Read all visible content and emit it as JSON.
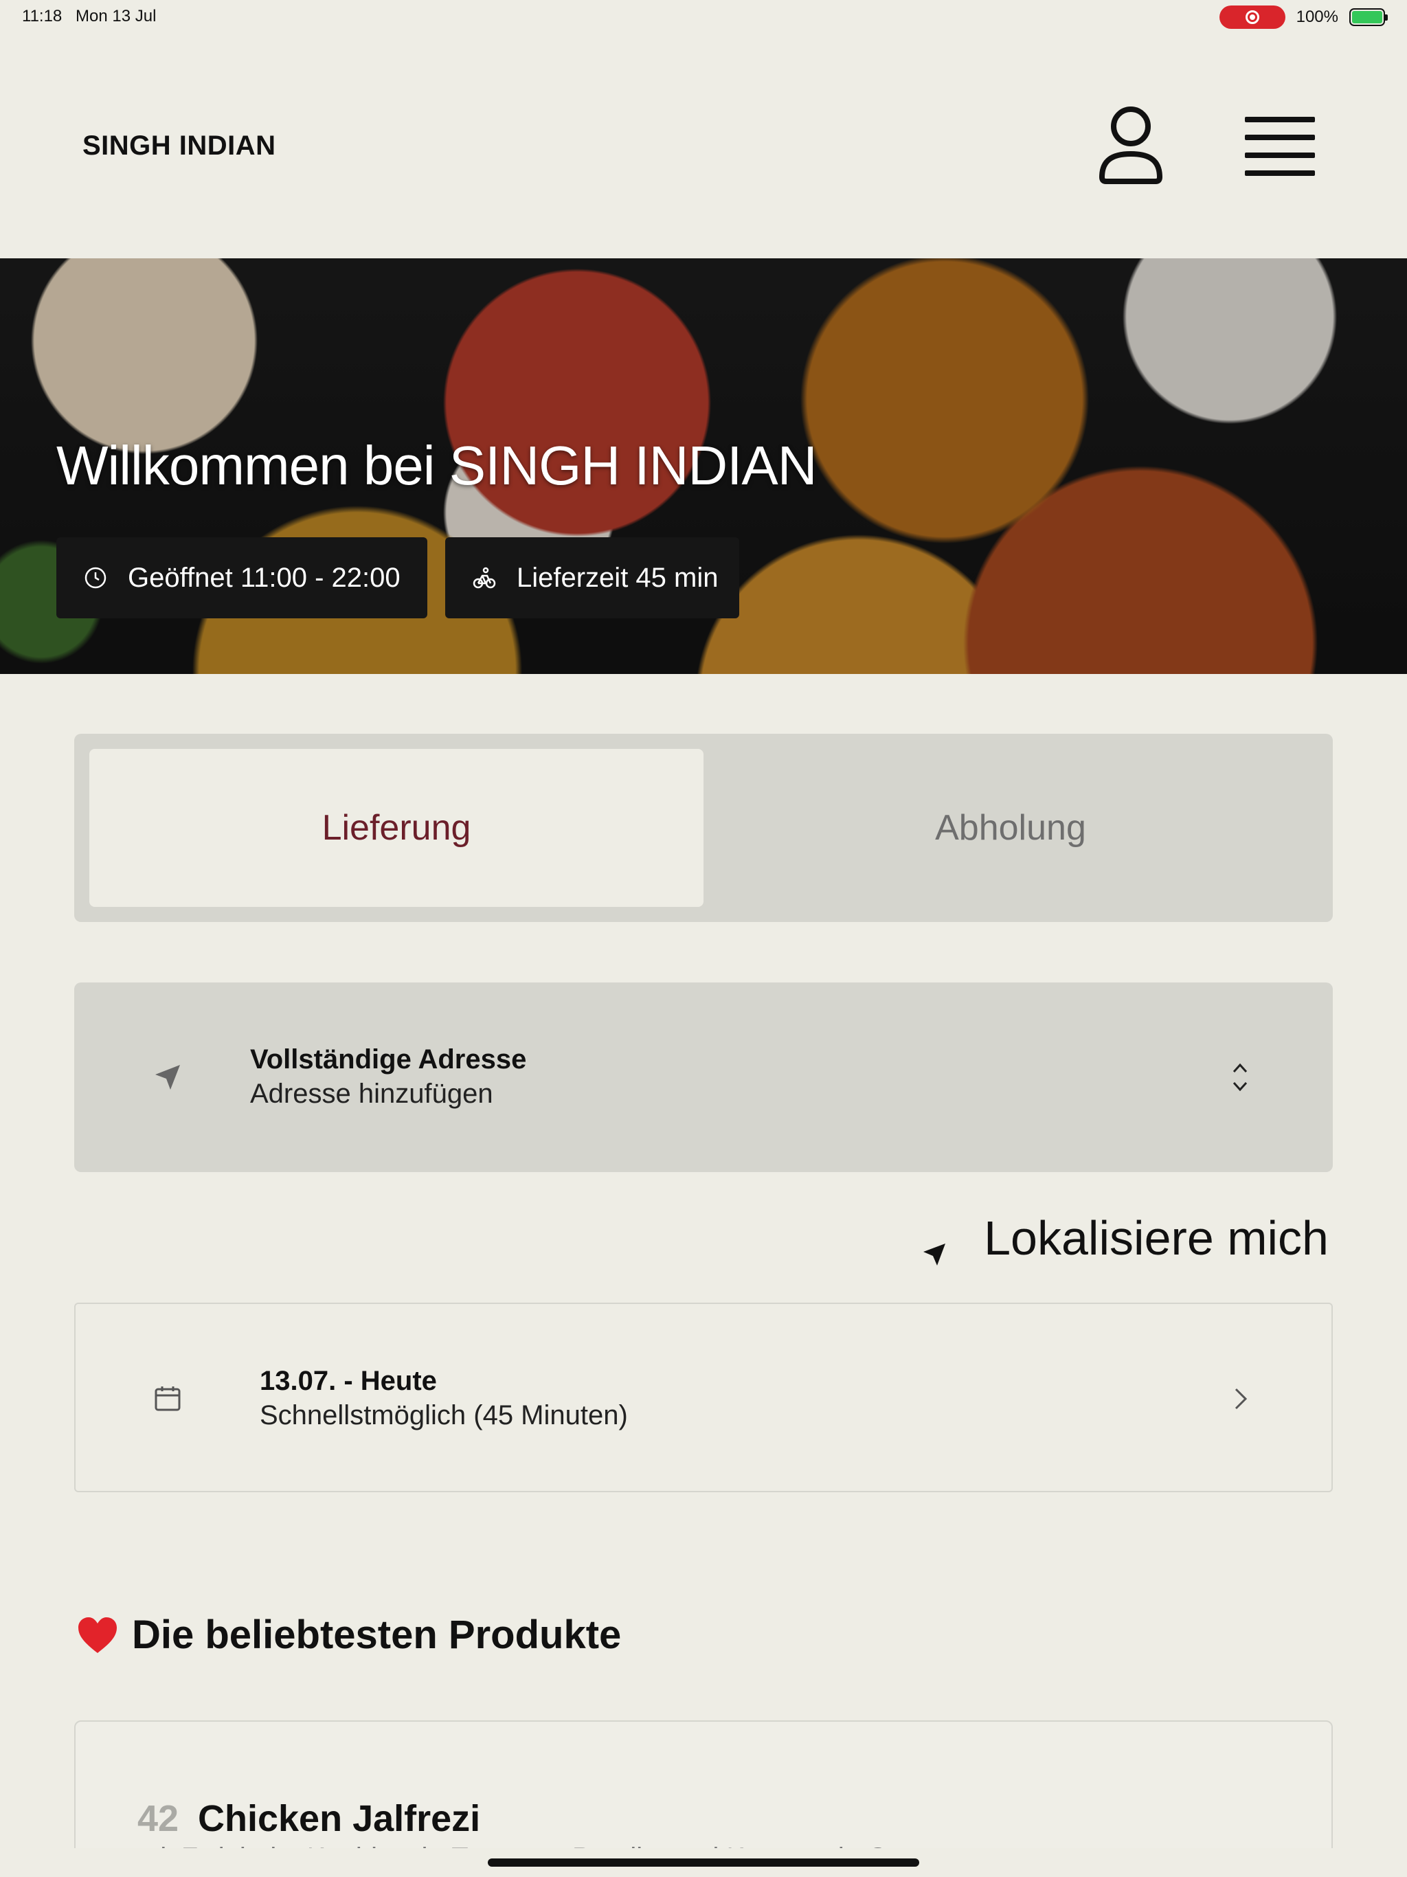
{
  "status_bar": {
    "time": "11:18",
    "date": "Mon 13 Jul",
    "battery": "100%"
  },
  "header": {
    "brand": "SINGH INDIAN"
  },
  "hero": {
    "title": "Willkommen bei SINGH INDIAN",
    "hours": "Geöffnet 11:00 - 22:00",
    "delivery_time": "Lieferzeit 45 min"
  },
  "order_type": {
    "delivery_label": "Lieferung",
    "pickup_label": "Abholung",
    "selected": "Lieferung"
  },
  "address": {
    "label": "Vollständige Adresse",
    "placeholder": "Adresse hinzufügen"
  },
  "locate": {
    "label": "Lokalisiere mich"
  },
  "schedule": {
    "date": "13.07. - Heute",
    "time": "Schnellstmöglich (45 Minuten)"
  },
  "popular": {
    "title": "Die beliebtesten Produkte",
    "products": [
      {
        "number": "42",
        "name": "Chicken Jalfrezi",
        "description": "mit Zwiebeln, Knoblauch, Tomaten, Paprika und Karotten in Currysauce"
      }
    ]
  },
  "colors": {
    "accent": "#6b1f2a",
    "background": "#eeede5",
    "panel": "#d5d5ce"
  },
  "icons": [
    "record-icon",
    "battery-icon",
    "user-icon",
    "hamburger-menu-icon",
    "clock-icon",
    "bicycle-icon",
    "location-arrow-icon",
    "chevron-updown-icon",
    "calendar-icon",
    "chevron-right-icon",
    "heart-icon"
  ]
}
